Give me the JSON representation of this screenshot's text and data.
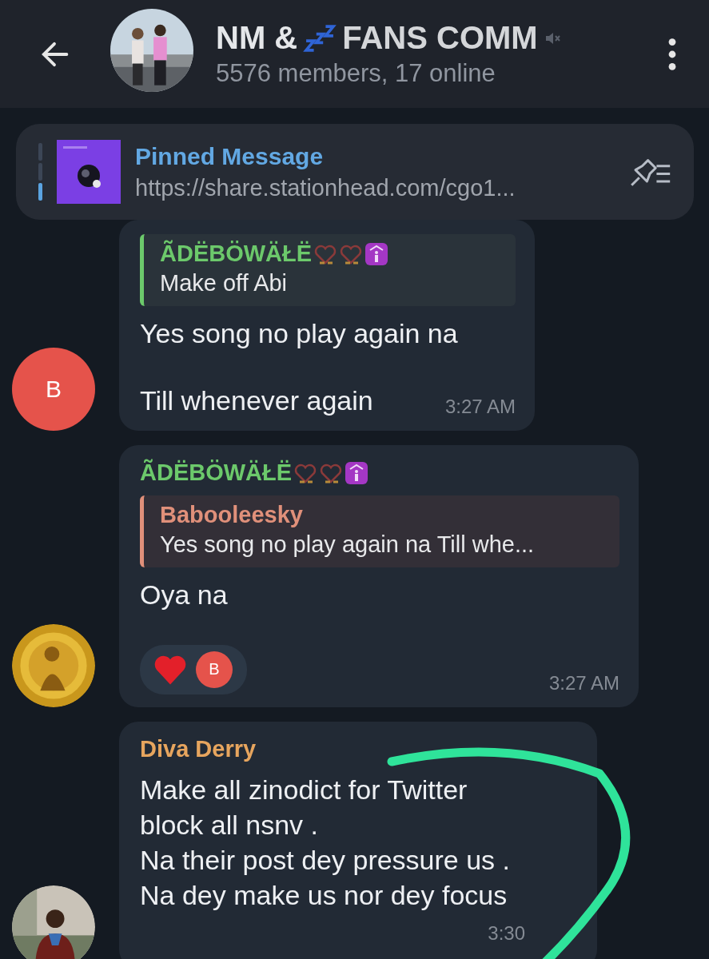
{
  "header": {
    "title_parts": [
      "NM &",
      "FANS COMM"
    ],
    "muted": true,
    "subtitle": "5576 members, 17 online"
  },
  "pinned": {
    "title": "Pinned Message",
    "text": "https://share.stationhead.com/cgo1..."
  },
  "messages": [
    {
      "avatar": {
        "kind": "letter",
        "letter": "B",
        "color": "#e5534b"
      },
      "reply": {
        "sender": "ÃDËBÖWÄŁË",
        "badges": true,
        "color": "#6cc96b",
        "text": "Make off Abi"
      },
      "paragraphs": [
        "Yes song no play again na",
        "Till whenever again"
      ],
      "time": "3:27 AM",
      "time_inline": true
    },
    {
      "avatar": {
        "kind": "picture"
      },
      "sender": {
        "name": "ÃDËBÖWÄŁË",
        "color": "#6cc96b"
      },
      "badges": true,
      "reply": {
        "sender": "Babooleesky",
        "badges": false,
        "color": "#e0907a",
        "text": "Yes song no play again na  Till whe..."
      },
      "paragraphs": [
        "Oya na"
      ],
      "reactions": [
        {
          "kind": "heart"
        },
        {
          "kind": "avatar",
          "letter": "B",
          "color": "#e5534b"
        }
      ],
      "time": "3:27 AM",
      "time_inline": false
    },
    {
      "avatar": {
        "kind": "picture"
      },
      "sender": {
        "name": "Diva Derry",
        "color": "#e7a55e"
      },
      "badges": false,
      "lines": [
        "Make all zinodict for Twitter",
        "block all nsnv .",
        "Na their post dey pressure us .",
        "Na dey make us nor dey focus"
      ],
      "time": "3:30",
      "time_inline": false
    }
  ]
}
